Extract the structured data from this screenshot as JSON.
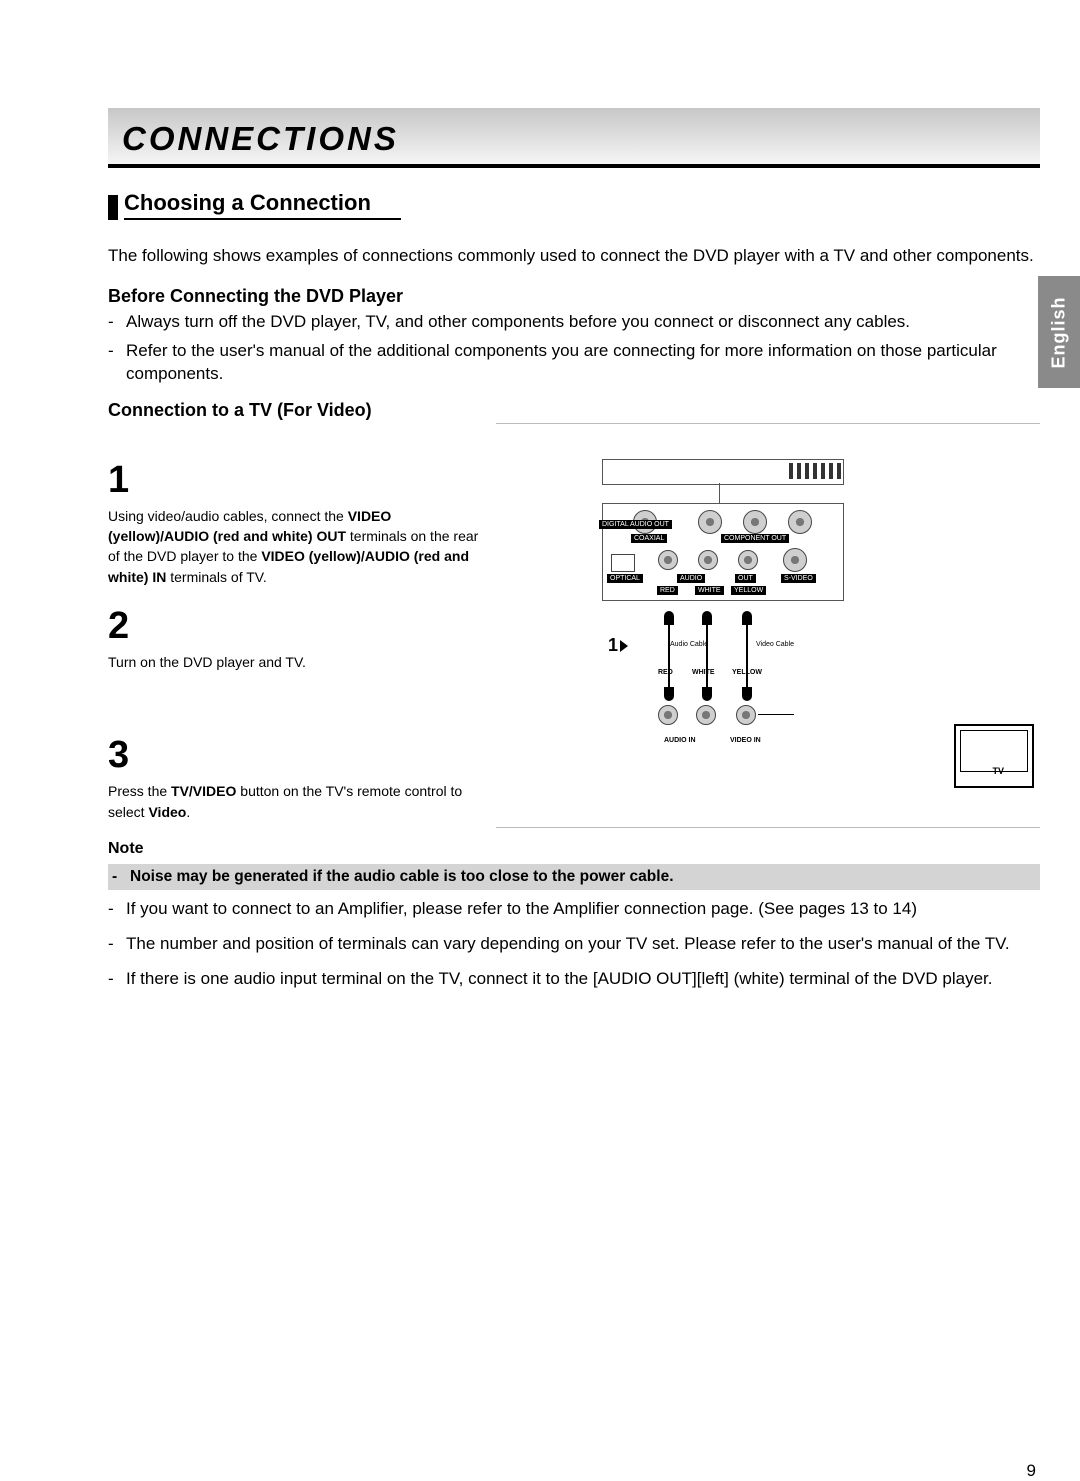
{
  "title": "CONNECTIONS",
  "language_tab": "English",
  "subheading": "Choosing a Connection",
  "intro": "The following shows examples of connections commonly used to connect the DVD player with a TV and other components.",
  "before": {
    "heading": "Before Connecting the DVD Player",
    "items": [
      "Always turn off the DVD player, TV, and other components before you connect or disconnect any cables.",
      "Refer to the user's manual of the additional components you are connecting for more information on those particular components."
    ]
  },
  "connection_heading": "Connection to a TV (For Video)",
  "steps": [
    {
      "num": "1",
      "parts": [
        {
          "t": "Using video/audio cables, connect the ",
          "b": false
        },
        {
          "t": "VIDEO (yellow)/AUDIO (red and white) OUT",
          "b": true
        },
        {
          "t": " terminals on the rear of the DVD player to the ",
          "b": false
        },
        {
          "t": "VIDEO (yellow)/AUDIO (red and white) IN",
          "b": true
        },
        {
          "t": " terminals of TV.",
          "b": false
        }
      ]
    },
    {
      "num": "2",
      "parts": [
        {
          "t": "Turn on the DVD player and TV.",
          "b": false
        }
      ]
    },
    {
      "num": "3",
      "parts": [
        {
          "t": "Press the ",
          "b": false
        },
        {
          "t": "TV/VIDEO",
          "b": true
        },
        {
          "t": " button on the TV's remote control to select ",
          "b": false
        },
        {
          "t": "Video",
          "b": true
        },
        {
          "t": ".",
          "b": false
        }
      ]
    }
  ],
  "note": {
    "heading": "Note",
    "highlight": "Noise may be generated if the audio cable is too close to the power cable.",
    "items": [
      "If you want to connect to an Amplifier, please refer to the Amplifier connection page. (See pages 13 to 14)",
      "The number and position of terminals can vary depending on your TV set. Please refer to the user's manual of the TV.",
      "If there is one audio input terminal on the TV, connect it to the [AUDIO OUT][left] (white) terminal of the DVD player."
    ]
  },
  "diagram": {
    "top_labels": {
      "digital": "DIGITAL AUDIO OUT",
      "coaxial": "COAXIAL",
      "component": "COMPONENT OUT"
    },
    "mid_labels": {
      "optical": "OPTICAL",
      "audio": "AUDIO",
      "out": "OUT",
      "svideo": "S-VIDEO"
    },
    "colors": {
      "red": "RED",
      "white": "WHITE",
      "yellow": "YELLOW"
    },
    "cable_labels": {
      "audio": "Audio Cable",
      "video": "Video Cable"
    },
    "bottom": {
      "audio_in": "AUDIO IN",
      "video_in": "VIDEO IN",
      "tv": "TV"
    },
    "step_marker": "1"
  },
  "page_number": "9"
}
